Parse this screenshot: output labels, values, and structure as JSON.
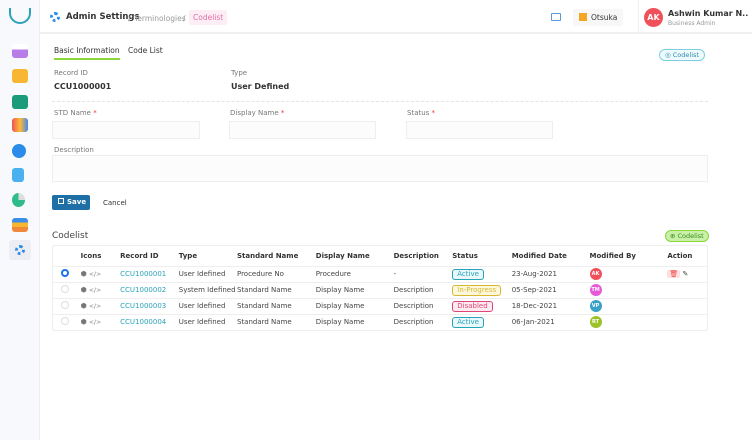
{
  "header": {
    "section": "Admin Settings",
    "breadcrumb_sep": "/",
    "breadcrumb_mid": "Terminologies",
    "breadcrumb_current": "Codelist",
    "org": "Otsuka",
    "user_initials": "AK",
    "user_name": "Ashwin Kumar N..",
    "user_role": "Business Admin"
  },
  "tabs": [
    {
      "label": "Basic Information",
      "active": true
    },
    {
      "label": "Code List",
      "active": false
    }
  ],
  "codelist_badge": "Codelist",
  "record": {
    "id_label": "Record ID",
    "id_value": "CCU1000001",
    "type_label": "Type",
    "type_value": "User Defined"
  },
  "form": {
    "std_name_label": "STD Name",
    "display_name_label": "Display Name",
    "status_label": "Status",
    "required_mark": "*",
    "description_label": "Description",
    "std_name_value": "",
    "display_name_value": "",
    "status_value": "",
    "description_value": "",
    "save_label": "Save",
    "cancel_label": "Cancel"
  },
  "table": {
    "title": "Codelist",
    "add_label": "Codelist",
    "columns": [
      "Icons",
      "Record ID",
      "Type",
      "Standard Name",
      "Display Name",
      "Description",
      "Status",
      "Modified Date",
      "Modified By",
      "Action"
    ],
    "rows": [
      {
        "selected": true,
        "record_id": "CCU1000001",
        "type": "User Idefined",
        "standard_name": "Procedure No",
        "display_name": "Procedure",
        "description": "-",
        "status": "Active",
        "modified_date": "23-Aug-2021",
        "modified_by": "AK",
        "avatar_color": "#f0505a"
      },
      {
        "selected": false,
        "record_id": "CCU1000002",
        "type": "System Idefined",
        "standard_name": "Standard Name",
        "display_name": "Display Name",
        "description": "Description",
        "status": "In-Progress",
        "modified_date": "05-Sep-2021",
        "modified_by": "TM",
        "avatar_color": "#e65ad8"
      },
      {
        "selected": false,
        "record_id": "CCU1000003",
        "type": "User Idefined",
        "standard_name": "Standard Name",
        "display_name": "Display Name",
        "description": "Description",
        "status": "Disabled",
        "modified_date": "18-Dec-2021",
        "modified_by": "VP",
        "avatar_color": "#3aa0c8"
      },
      {
        "selected": false,
        "record_id": "CCU1000004",
        "type": "User Idefined",
        "standard_name": "Standard Name",
        "display_name": "Display Name",
        "description": "Description",
        "status": "Active",
        "modified_date": "06-Jan-2021",
        "modified_by": "RT",
        "avatar_color": "#9cc22a"
      }
    ]
  },
  "colors": {
    "accent": "#1d6fa5",
    "tab_underline": "#8bd63a",
    "active": "#2aa3b8",
    "inprogress": "#e8c84a",
    "disabled": "#e0457a"
  }
}
